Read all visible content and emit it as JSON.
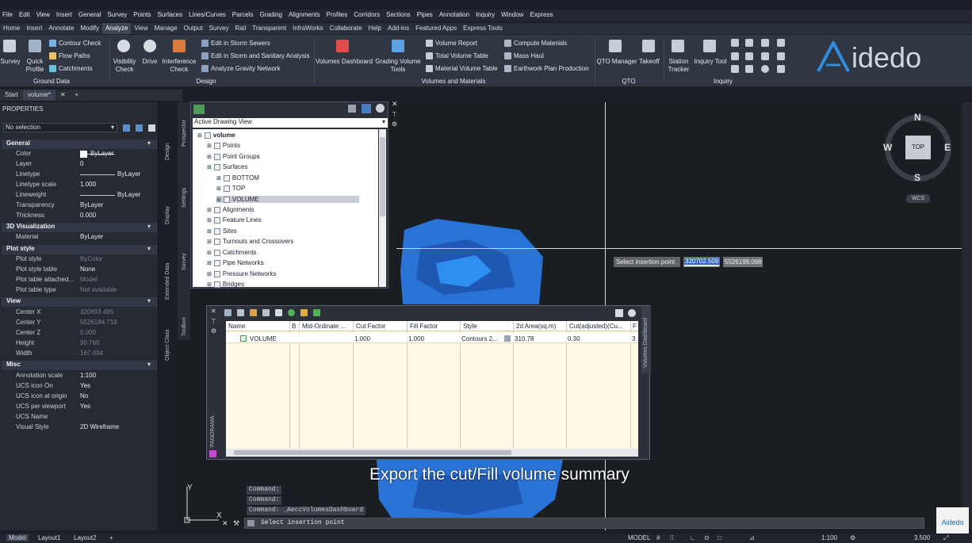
{
  "menu": [
    "File",
    "Edit",
    "View",
    "Insert",
    "General",
    "Survey",
    "Points",
    "Surfaces",
    "Lines/Curves",
    "Parcels",
    "Grading",
    "Alignments",
    "Profiles",
    "Corridors",
    "Sections",
    "Pipes",
    "Annotation",
    "Inquiry",
    "Window",
    "Express"
  ],
  "tabs": [
    "Home",
    "Insert",
    "Annotate",
    "Modify",
    "Analyze",
    "View",
    "Manage",
    "Output",
    "Survey",
    "Rail",
    "Transparent",
    "InfraWorks",
    "Collaborate",
    "Help",
    "Add-ins",
    "Featured Apps",
    "Express Tools"
  ],
  "ribbon": {
    "survey": "Survey",
    "quick_profile_1": "Quick",
    "quick_profile_2": "Profile",
    "contour_check": "Contour Check",
    "flow_paths": "Flow Paths",
    "catchments": "Catchments",
    "ground_data": "Ground Data",
    "visibility_1": "Visibility",
    "visibility_2": "Check",
    "drive": "Drive",
    "interference_1": "Interference",
    "interference_2": "Check",
    "edit_storm": "Edit in Storm Sewers",
    "edit_storm_sanitary": "Edit in Storm and Sanitary Analysis",
    "gravity": "Analyze Gravity Network",
    "design": "Design",
    "volumes_dashboard": "Volumes Dashboard",
    "grading_vol_1": "Grading Volume",
    "grading_vol_2": "Tools",
    "volume_report": "Volume Report",
    "total_volume_table": "Total Volume Table",
    "material_volume_table": "Material Volume Table",
    "compute_materials": "Compute Materials",
    "mass_haul": "Mass Haul",
    "earthwork_plan": "Earthwork Plan Production",
    "volumes_materials": "Volumes and Materials",
    "qto_manager": "QTO Manager",
    "takeoff": "Takeoff",
    "qto": "QTO",
    "station_tracker_1": "Station",
    "station_tracker_2": "Tracker",
    "inquiry_tool": "Inquiry Tool",
    "inquiry": "Inquiry"
  },
  "logo": "idedo",
  "doc_tabs": {
    "start": "Start",
    "volume": "volume*"
  },
  "properties": {
    "title": "PROPERTIES",
    "selection": "No selection",
    "general": "General",
    "color_l": "Color",
    "color_v": "ByLayer",
    "layer_l": "Layer",
    "layer_v": "0",
    "linetype_l": "Linetype",
    "linetype_v": "ByLayer",
    "ltscale_l": "Linetype scale",
    "ltscale_v": "1.000",
    "lineweight_l": "Lineweight",
    "lineweight_v": "ByLayer",
    "transparency_l": "Transparency",
    "transparency_v": "ByLayer",
    "thickness_l": "Thickness",
    "thickness_v": "0.000",
    "viz": "3D Visualization",
    "material_l": "Material",
    "material_v": "ByLayer",
    "plot": "Plot style",
    "plotstyle_l": "Plot style",
    "plotstyle_v": "ByColor",
    "plottable_l": "Plot style table",
    "plottable_v": "None",
    "plotattached_l": "Plot table attached...",
    "plotattached_v": "Model",
    "plottype_l": "Plot table type",
    "plottype_v": "Not available",
    "view": "View",
    "cx_l": "Center X",
    "cx_v": "320693.495",
    "cy_l": "Center Y",
    "cy_v": "5526184.719",
    "cz_l": "Center Z",
    "cz_v": "0.000",
    "h_l": "Height",
    "h_v": "90.760",
    "w_l": "Width",
    "w_v": "167.094",
    "misc": "Misc",
    "annoscale_l": "Annotation scale",
    "annoscale_v": "1:100",
    "ucson_l": "UCS icon On",
    "ucson_v": "Yes",
    "ucsorigin_l": "UCS icon at origin",
    "ucsorigin_v": "No",
    "ucsvp_l": "UCS per viewport",
    "ucsvp_v": "Yes",
    "ucsname_l": "UCS Name",
    "ucsname_v": "",
    "visual_l": "Visual Style",
    "visual_v": "2D Wireframe"
  },
  "side_tabs": {
    "design": "Design",
    "display": "Display",
    "extended": "Extended Data",
    "objclass": "Object Class",
    "prospector": "Prospector",
    "settings": "Settings",
    "survey": "Survey",
    "toolbox": "Toolbox",
    "panorama": "PANORAMA",
    "volumes_dashboard": "Volumes Dashboard"
  },
  "prospector": {
    "view": "Active Drawing View",
    "root": "volume",
    "points": "Points",
    "point_groups": "Point Groups",
    "surfaces": "Surfaces",
    "bottom": "BOTTOM",
    "top": "TOP",
    "volume": "VOLUME",
    "alignments": "Alignments",
    "feature_lines": "Feature Lines",
    "sites": "Sites",
    "turnouts": "Turnouts and Crossovers",
    "catchments": "Catchments",
    "pipe_networks": "Pipe Networks",
    "pressure_networks": "Pressure Networks",
    "bridges": "Bridges"
  },
  "table": {
    "headers": [
      "Name",
      "B",
      "Mid-Ordinate ...",
      "Cut Factor",
      "Fill Factor",
      "Style",
      "2d Area(sq.m)",
      "Cut(adjusted)(Cu...",
      "F"
    ],
    "row": {
      "name": "VOLUME",
      "cut_factor": "1.000",
      "fill_factor": "1.000",
      "style": "Contours 2...",
      "area": "310.78",
      "cut": "0.30",
      "f": "3"
    }
  },
  "compass": {
    "n": "N",
    "s": "S",
    "e": "E",
    "w": "W",
    "top": "TOP",
    "wcs": "WCS"
  },
  "tooltip": {
    "prompt": "Select insertion point",
    "x": "320702.509",
    "y": "5526198.068"
  },
  "subtitle": "Export the cut/Fill volume summary",
  "command": {
    "h1": "Command:",
    "h2": "Command:",
    "h3": "Command: _AeccVolumesDashboard",
    "input": "Select insertion point"
  },
  "status": {
    "model": "Model",
    "layout1": "Layout1",
    "layout2": "Layout2",
    "model_btn": "MODEL",
    "scale": "1:100",
    "units": "3.500"
  },
  "axis": {
    "y": "Y",
    "x": "X"
  },
  "watermark": "Aidedo"
}
